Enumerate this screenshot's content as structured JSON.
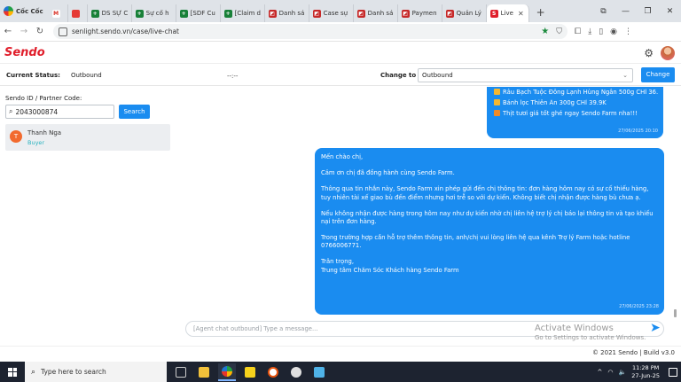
{
  "browser": {
    "name": "Cốc Cốc",
    "tabs": [
      {
        "label": "",
        "icon": "gmail-icon",
        "color": "#d93025",
        "glyph": "M"
      },
      {
        "label": "",
        "icon": "sheets-icon",
        "color": "#e53935",
        "glyph": ""
      },
      {
        "label": "DS SỰ C",
        "icon": "sheets-icon",
        "color": "#188038",
        "glyph": "+"
      },
      {
        "label": "Sự cố h",
        "icon": "sheets-icon",
        "color": "#188038",
        "glyph": "+"
      },
      {
        "label": "[SDF Cu",
        "icon": "sheets-icon",
        "color": "#188038",
        "glyph": "+"
      },
      {
        "label": "[Claim d",
        "icon": "sheets-icon",
        "color": "#188038",
        "glyph": "+"
      },
      {
        "label": "Danh sá",
        "icon": "report-icon",
        "color": "#c62828",
        "glyph": "◩"
      },
      {
        "label": "Case sự",
        "icon": "report-icon",
        "color": "#c62828",
        "glyph": "◩"
      },
      {
        "label": "Danh sá",
        "icon": "report-icon",
        "color": "#c62828",
        "glyph": "◩"
      },
      {
        "label": "Paymen",
        "icon": "report-icon",
        "color": "#c62828",
        "glyph": "◩"
      },
      {
        "label": "Quản Lý",
        "icon": "report-icon",
        "color": "#c62828",
        "glyph": "◩"
      },
      {
        "label": "Live",
        "icon": "sendo-icon",
        "color": "#e01e2b",
        "glyph": "S",
        "active": true
      }
    ],
    "new_tab": "+",
    "url": "senlight.sendo.vn/case/live-chat"
  },
  "app": {
    "logo": "Sendo",
    "status": {
      "current_label": "Current Status:",
      "current_value": "Outbound",
      "timer": "--:--",
      "change_to_label": "Change to",
      "select_value": "Outbound",
      "change_button": "Change"
    },
    "search": {
      "label": "Sendo ID / Partner Code:",
      "value": "2043000874",
      "button": "Search"
    },
    "contact": {
      "initial": "T",
      "name": "Thanh Nga",
      "role": "Buyer"
    },
    "messages": {
      "top": {
        "lines": [
          "Râu Bạch Tuộc Đông Lạnh Hùng Ngân 500g CHỈ 36.5K",
          "Bánh lọc Thiên Ân 300g CHỈ 39.9K",
          "Thịt tươi giá tốt ghé ngay Sendo Farm nha!!!"
        ],
        "time": "27/06/2025 20:10"
      },
      "main": {
        "greeting": "Mến chào chị,",
        "p1": "Cảm ơn chị đã đồng hành cùng Sendo Farm.",
        "p2": "Thông qua tin nhắn này, Sendo Farm xin phép gửi đến chị thông tin: đơn hàng hôm nay có sự cố thiếu hàng, tuy nhiên tài xế giao bù đến điểm nhưng hơi trễ so với dự kiến. Không biết chị nhận được hàng bù chưa ạ.",
        "p3": "Nếu không nhận được hàng trong hôm nay như dự kiến nhờ chị liên hệ trợ lý chị báo lại thông tin và tạo khiếu nại trên đơn hàng.",
        "p4": "Trong trường hợp cần hỗ trợ thêm thông tin, anh/chị vui lòng liên hệ qua kênh Trợ lý Farm hoặc hotline 0766006771.",
        "closing1": "Trân trọng,",
        "closing2": "Trung tâm Chăm Sóc Khách hàng Sendo Farm",
        "time": "27/06/2025 23:28"
      }
    },
    "composer_placeholder": "[Agent chat outbound] Type a message...",
    "footer": "© 2021 Sendo | Build v3.0"
  },
  "os": {
    "watermark_title": "Activate Windows",
    "watermark_sub": "Go to Settings to activate Windows.",
    "search_placeholder": "Type here to search",
    "time": "11:28 PM",
    "date": "27-Jun-25"
  }
}
